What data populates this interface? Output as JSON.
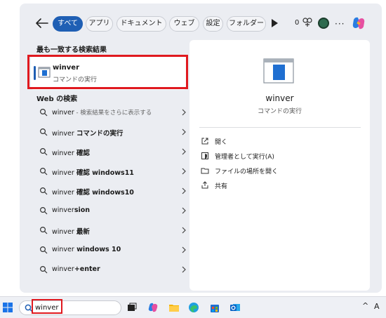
{
  "filters": {
    "back_icon": "arrow-left-icon",
    "tabs": [
      "すべて",
      "アプリ",
      "ドキュメント",
      "ウェブ",
      "設定",
      "フォルダー"
    ],
    "active_tab": "すべて",
    "play_icon": "play-icon",
    "reward_count": "0",
    "reward_icon": "rewards-icon",
    "more_icon": "ellipsis-icon",
    "copilot_icon": "copilot-icon"
  },
  "best_match": {
    "heading": "最も一致する検索結果",
    "name": "winver",
    "subtitle": "コマンドの実行",
    "icon": "window-app-icon"
  },
  "web": {
    "heading": "Web の検索",
    "results": [
      {
        "prefix": "winver",
        "suffix": " - 検索結果をさらに表示する",
        "bold": ""
      },
      {
        "prefix": "winver ",
        "suffix": "",
        "bold": "コマンドの実行"
      },
      {
        "prefix": "winver ",
        "suffix": "",
        "bold": "確認"
      },
      {
        "prefix": "winver ",
        "suffix": "",
        "bold": "確認 windows11"
      },
      {
        "prefix": "winver ",
        "suffix": "",
        "bold": "確認 windows10"
      },
      {
        "prefix": "winver",
        "suffix": "",
        "bold": "sion"
      },
      {
        "prefix": "winver ",
        "suffix": "",
        "bold": "最新"
      },
      {
        "prefix": "winver",
        "suffix": "",
        "bold": " windows 10"
      },
      {
        "prefix": "winver",
        "suffix": "",
        "bold": "+enter"
      }
    ]
  },
  "preview": {
    "name": "winver",
    "subtitle": "コマンドの実行",
    "actions": [
      {
        "label": "開く",
        "icon": "open-external-icon"
      },
      {
        "label": "管理者として実行(A)",
        "icon": "shield-admin-icon"
      },
      {
        "label": "ファイルの場所を開く",
        "icon": "folder-icon"
      },
      {
        "label": "共有",
        "icon": "share-icon"
      }
    ]
  },
  "taskbar": {
    "search_value": "winver",
    "tray_chevron": "^",
    "language": "A",
    "icons": [
      "start-icon",
      "task-view-icon",
      "copilot-icon",
      "file-explorer-icon",
      "edge-icon",
      "store-icon",
      "outlook-icon"
    ]
  },
  "colors": {
    "accent": "#1f5fb4",
    "highlight": "#e0191f",
    "panel_bg": "#ebedf2"
  }
}
